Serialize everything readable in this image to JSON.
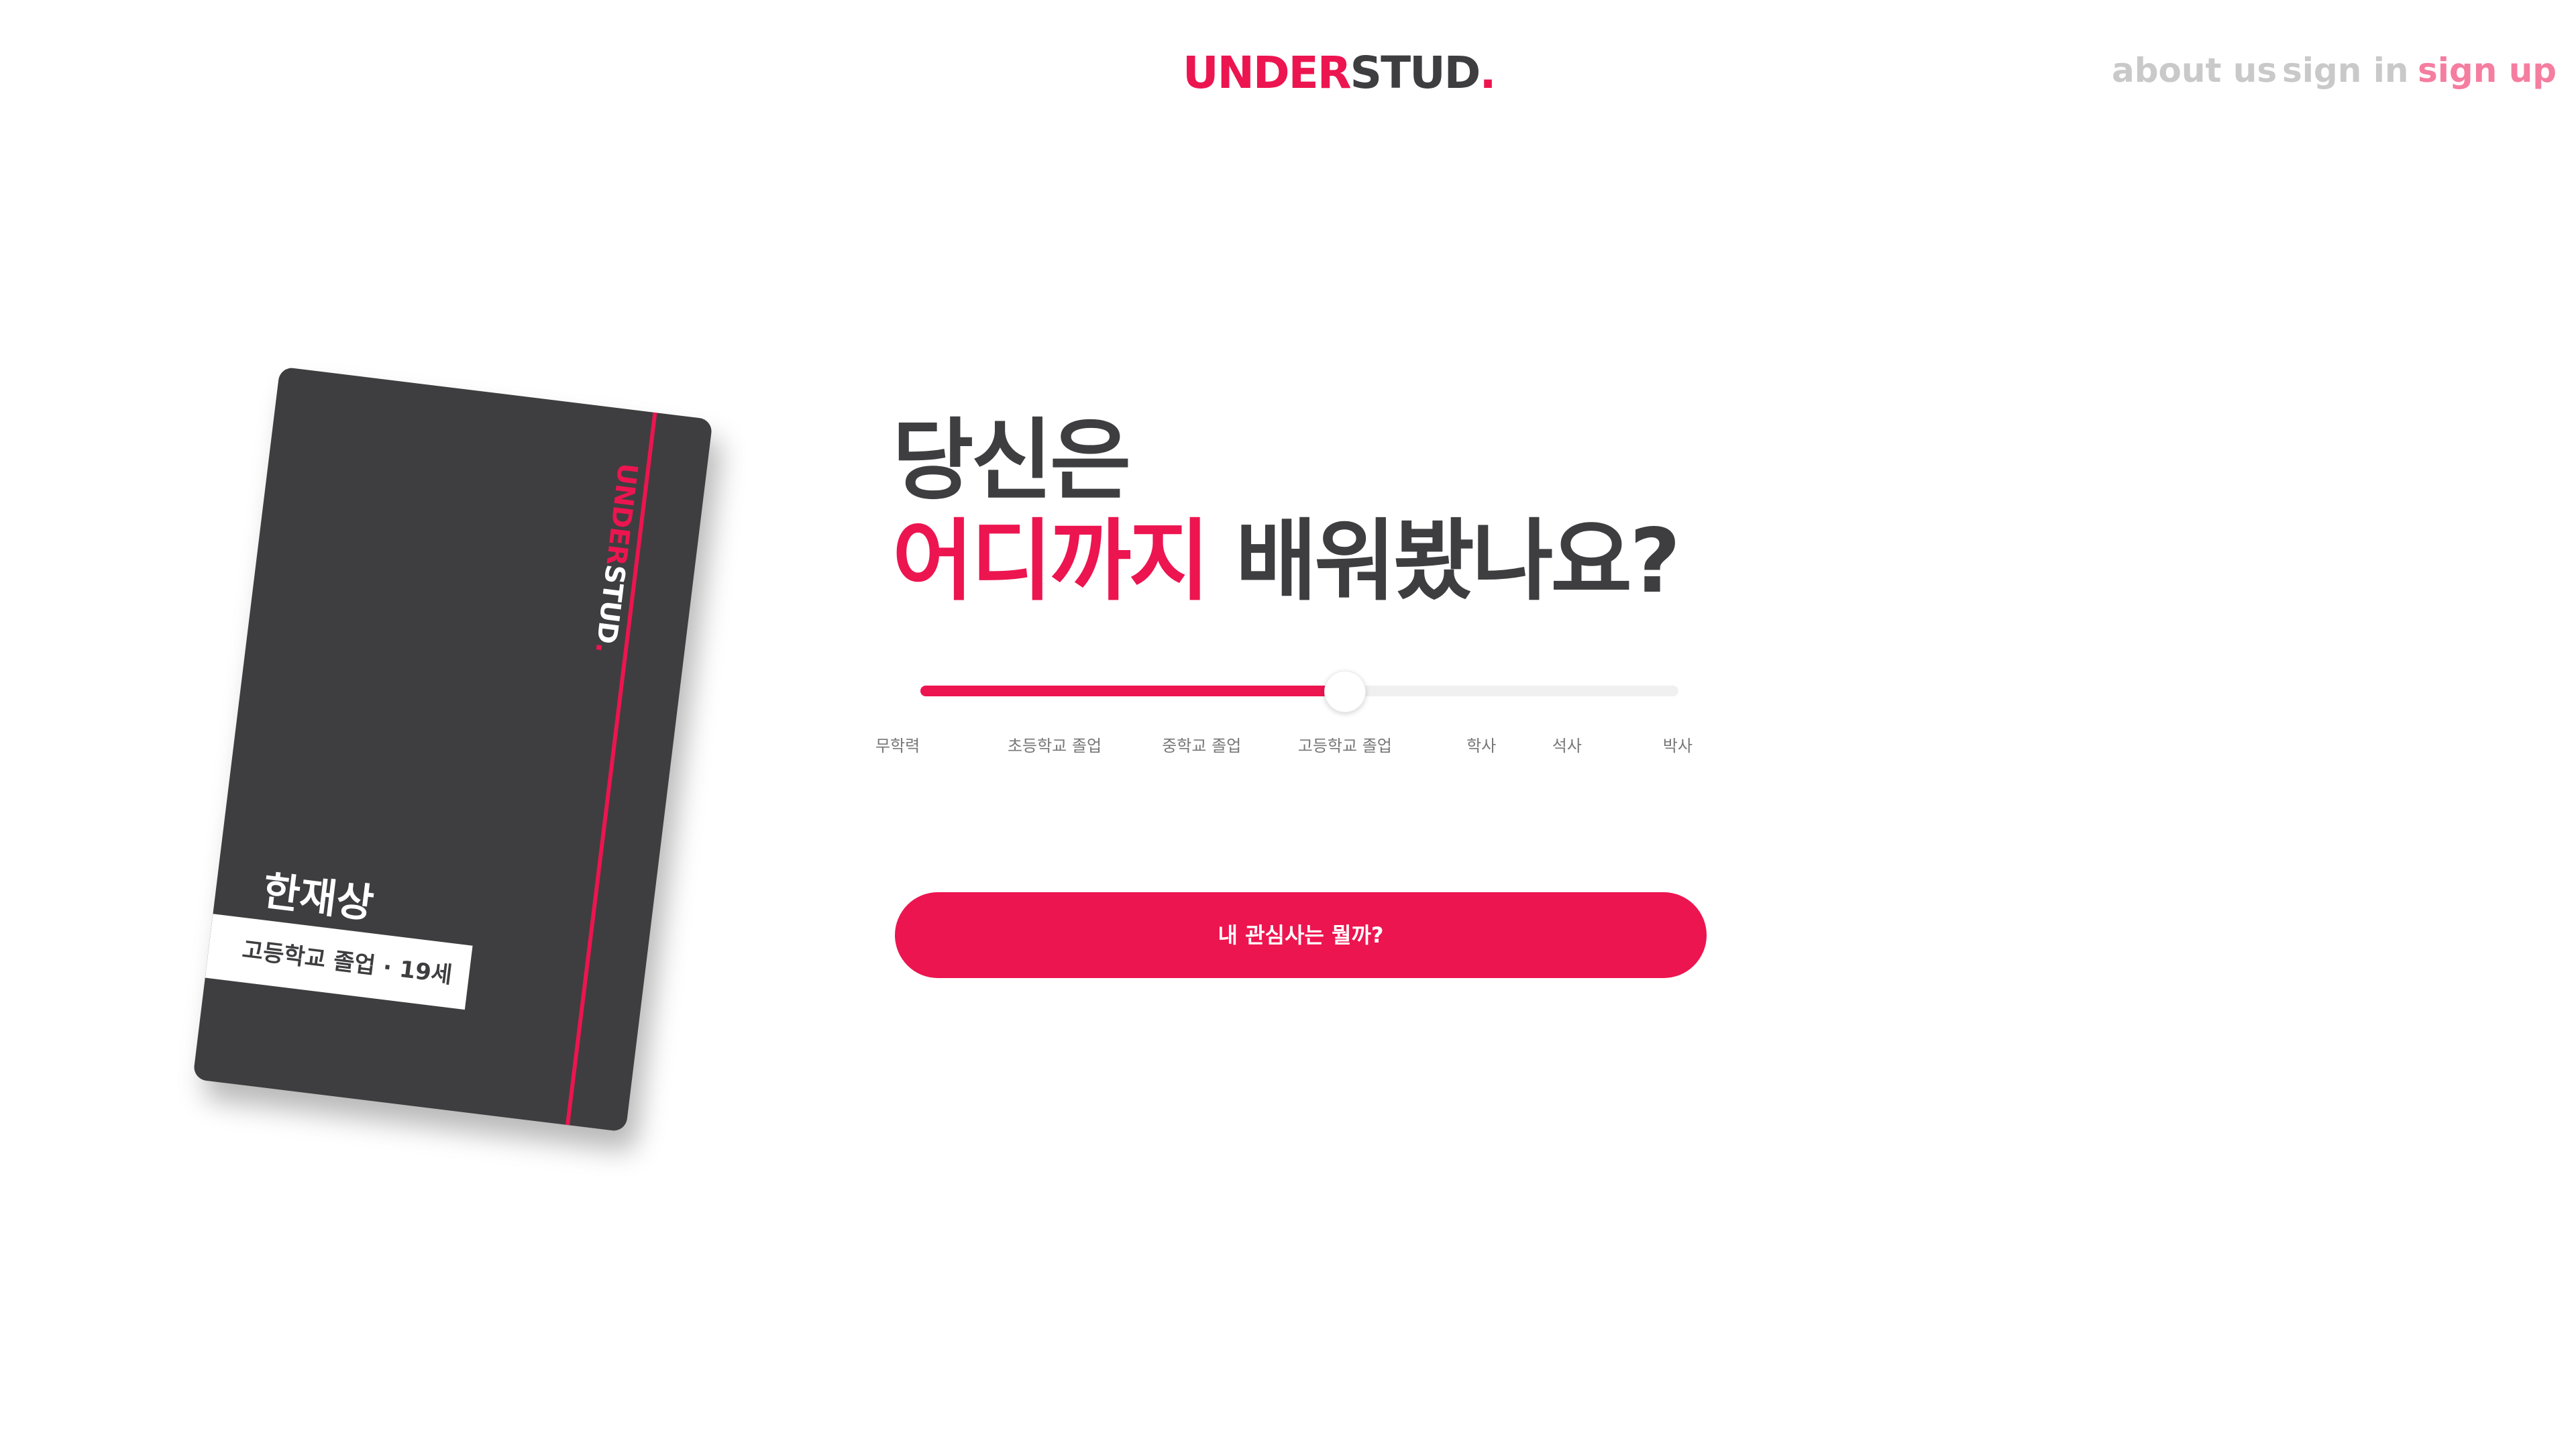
{
  "colors": {
    "accent": "#ec1550",
    "dark": "#3e3e40",
    "card_bg": "#3e3e40",
    "nav_muted": "#c9c9c9",
    "nav_active": "#f57da0"
  },
  "header": {
    "logo": {
      "part1": "UNDER",
      "part2": "STUD",
      "part3": "."
    },
    "nav": {
      "about": "about us",
      "sign_in": "sign in",
      "sign_up": "sign up"
    }
  },
  "card": {
    "brand": {
      "part1": "UNDER",
      "part2": "STUD",
      "part3": "."
    },
    "name": "한재상",
    "tag": "고등학교 졸업 · 19세"
  },
  "headline": {
    "line1": "당신은",
    "line2_accent": "어디까지",
    "line2_rest": " 배워봤나요?"
  },
  "education_slider": {
    "value_fraction": 0.56,
    "selected": "고등학교 졸업",
    "ticks": [
      {
        "label": "무학력",
        "fraction": -0.03
      },
      {
        "label": "초등학교 졸업",
        "fraction": 0.177
      },
      {
        "label": "중학교 졸업",
        "fraction": 0.371
      },
      {
        "label": "고등학교 졸업",
        "fraction": 0.56
      },
      {
        "label": "학사",
        "fraction": 0.74
      },
      {
        "label": "석사",
        "fraction": 0.853
      },
      {
        "label": "박사",
        "fraction": 0.999
      }
    ]
  },
  "cta": {
    "label": "내 관심사는 뭘까?"
  }
}
